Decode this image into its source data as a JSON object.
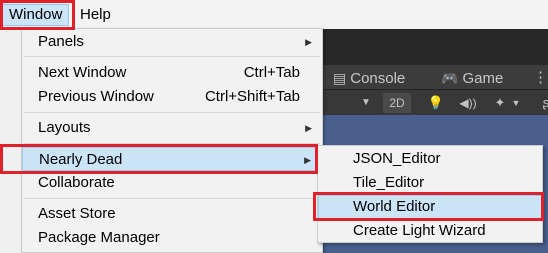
{
  "menubar": {
    "items": [
      {
        "label": "Window"
      },
      {
        "label": "Help"
      }
    ]
  },
  "editor": {
    "tabs": [
      {
        "label": "Console",
        "icon": "console-icon"
      },
      {
        "label": "Game",
        "icon": "gamepad-icon"
      },
      {
        "label": "⋮"
      }
    ],
    "toolbar": {
      "mode_2d": "2D"
    },
    "colors": {
      "panel_dark": "#282828",
      "tab_bar": "#3c3c3c",
      "scene_view": "#4a5f8e"
    }
  },
  "window_menu": {
    "items": [
      {
        "label": "Panels",
        "has_submenu": true
      },
      {
        "label": "Next Window",
        "shortcut": "Ctrl+Tab"
      },
      {
        "label": "Previous Window",
        "shortcut": "Ctrl+Shift+Tab"
      },
      {
        "label": "Layouts",
        "has_submenu": true
      },
      {
        "label": "Nearly Dead",
        "has_submenu": true,
        "highlighted": true
      },
      {
        "label": "Collaborate"
      },
      {
        "label": "Asset Store"
      },
      {
        "label": "Package Manager"
      }
    ]
  },
  "nearly_dead_submenu": {
    "items": [
      {
        "label": "JSON_Editor"
      },
      {
        "label": "Tile_Editor"
      },
      {
        "label": "World Editor",
        "highlighted": true
      },
      {
        "label": "Create Light Wizard"
      }
    ]
  },
  "annotation": {
    "color": "#e0202a"
  },
  "highlight": {
    "fill": "#cce4f7",
    "border": "#99c9ef"
  }
}
